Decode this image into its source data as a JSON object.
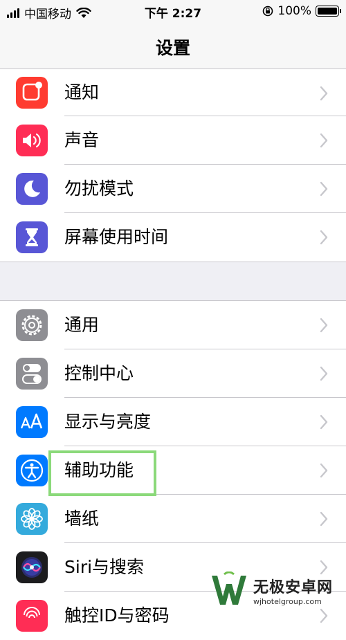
{
  "status_bar": {
    "carrier": "中国移动",
    "time": "下午 2:27",
    "battery": "100%"
  },
  "nav": {
    "title": "设置"
  },
  "groups": [
    {
      "items": [
        {
          "label": "通知",
          "icon": "notification-icon",
          "color": "#ff3b30"
        },
        {
          "label": "声音",
          "icon": "speaker-icon",
          "color": "#ff2d55"
        },
        {
          "label": "勿扰模式",
          "icon": "moon-icon",
          "color": "#5856d6"
        },
        {
          "label": "屏幕使用时间",
          "icon": "hourglass-icon",
          "color": "#5856d6"
        }
      ]
    },
    {
      "items": [
        {
          "label": "通用",
          "icon": "gear-icon",
          "color": "#8e8e93"
        },
        {
          "label": "控制中心",
          "icon": "toggles-icon",
          "color": "#8e8e93"
        },
        {
          "label": "显示与亮度",
          "icon": "text-size-icon",
          "color": "#007aff"
        },
        {
          "label": "辅助功能",
          "icon": "accessibility-icon",
          "color": "#007aff"
        },
        {
          "label": "墙纸",
          "icon": "flower-icon",
          "color": "#34aadc"
        },
        {
          "label": "Siri与搜索",
          "icon": "siri-icon",
          "color": "#1c1c1e"
        },
        {
          "label": "触控ID与密码",
          "icon": "fingerprint-icon",
          "color": "#ff2d55"
        }
      ]
    }
  ],
  "watermark": {
    "title": "无极安卓网",
    "url": "wjhotelgroup.com"
  }
}
